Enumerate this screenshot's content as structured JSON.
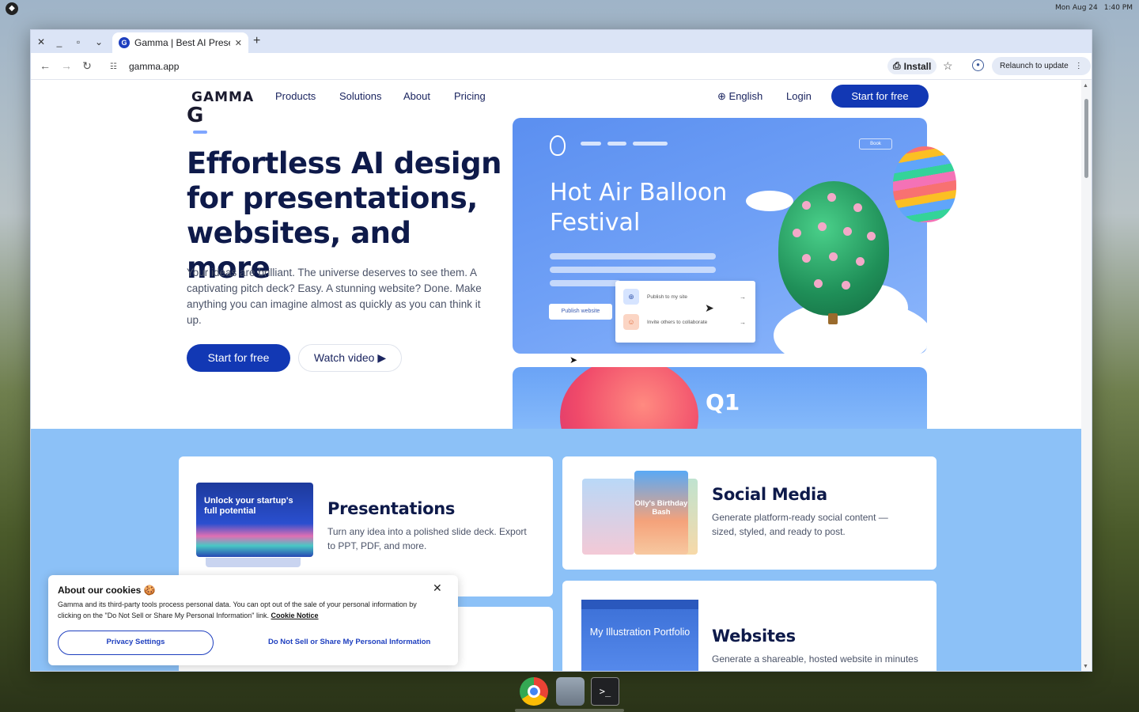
{
  "os": {
    "clock_date": "Mon Aug 24",
    "clock_time": "1:40 PM"
  },
  "browser": {
    "tab_title": "Gamma | Best AI Prese",
    "tab_favicon": "G",
    "url": "gamma.app",
    "install_label": "Install",
    "relaunch_label": "Relaunch to update",
    "icons": [
      "close-icon",
      "minimize-icon",
      "maximize-icon",
      "chevron-down-icon",
      "new-tab-icon",
      "back-icon",
      "forward-icon",
      "reload-icon",
      "site-info-icon",
      "install-icon",
      "star-icon",
      "profile-icon",
      "kebab-menu-icon"
    ]
  },
  "nav": {
    "logo": "GAMMA",
    "links": [
      "Products",
      "Solutions",
      "About",
      "Pricing"
    ],
    "language": "English",
    "login": "Login",
    "cta": "Start for free"
  },
  "hero": {
    "mark": "G",
    "title": "Effortless AI design for presentations, websites, and more",
    "description": "Your ideas are brilliant. The universe deserves to see them. A captivating pitch deck? Easy. A stunning website? Done. Make anything you can imagine almost as quickly as you can think it up.",
    "cta_primary": "Start for free",
    "cta_secondary": "Watch video"
  },
  "hero_card": {
    "book_label": "Book",
    "title": "Hot Air Balloon Festival",
    "publish_label": "Publish website",
    "popup_rows": [
      {
        "label": "Publish to my site",
        "icon": "globe-icon"
      },
      {
        "label": "Invite others to collaborate",
        "icon": "user-add-icon"
      }
    ]
  },
  "second_card": {
    "title": "Q1"
  },
  "features": [
    {
      "title": "Presentations",
      "description": "Turn any idea into a polished slide deck. Export to PPT, PDF, and more.",
      "thumb_text": "Unlock your startup's full potential"
    },
    {
      "title": "Social Media",
      "description": "Generate platform-ready social content — sized, styled, and ready to post.",
      "thumb_text": "Olly's Birthday Bash"
    },
    {
      "title": "Websites",
      "description": "Generate a shareable, hosted website in minutes",
      "thumb_text": "My Illustration Portfolio"
    }
  ],
  "cookie": {
    "title": "About our cookies 🍪",
    "text": "Gamma and its third-party tools process personal data. You can opt out of the sale of your personal information by clicking on the \"Do Not Sell or Share My Personal Information\" link.",
    "notice_link": "Cookie Notice",
    "privacy_button": "Privacy Settings",
    "do_not_sell": "Do Not Sell or Share My Personal Information"
  },
  "shelf": [
    "chrome-icon",
    "files-icon",
    "terminal-icon"
  ],
  "colors": {
    "brand_blue": "#1238b4",
    "features_bg": "#8cc1f7",
    "hero_text": "#0e1a4a"
  }
}
